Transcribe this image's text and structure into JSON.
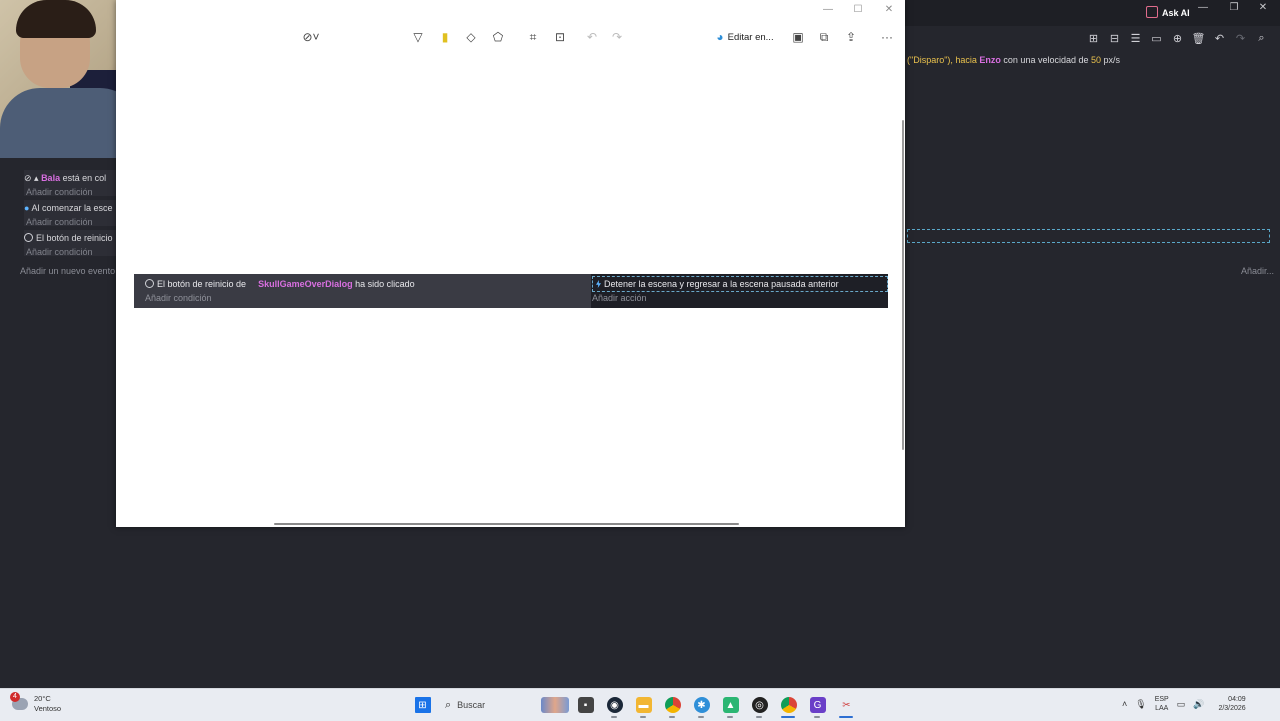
{
  "background_editor": {
    "ask_ai_label": "Ask AI",
    "event_text": {
      "prefix": "(\"Disparo\"), hacia ",
      "object": "Enzo",
      "middle": " con una velocidad de ",
      "speed": "50",
      "unit": " px/s"
    },
    "left_rows": [
      {
        "object": "Bala",
        "text": " está en col"
      },
      {
        "text": "Al comenzar la esce"
      },
      {
        "text": "El botón de reinicio"
      }
    ],
    "add_condition": "Añadir condición",
    "add_event": "Añadir un nuevo evento",
    "add_right": "Añadir..."
  },
  "snip_tool": {
    "edit_in_label": "Editar en...",
    "icons": [
      "timer-icon",
      "pen-icon",
      "highlighter-icon",
      "eraser-icon",
      "shape-icon",
      "crop-icon",
      "text-actions-icon",
      "undo-icon",
      "redo-icon",
      "edit-in-icon",
      "save-icon",
      "copy-icon",
      "share-icon",
      "more-icon"
    ]
  },
  "captured_event": {
    "condition_prefix": "El botón de reinicio de",
    "condition_object": "SkullGameOverDialog",
    "condition_suffix": " ha sido clicado",
    "add_condition": "Añadir condición",
    "action_text": "Detener la escena y regresar a la escena pausada anterior",
    "add_action": "Añadir acción"
  },
  "taskbar": {
    "weather_temp": "20°C",
    "weather_desc": "Ventoso",
    "weather_badge": "4",
    "search_placeholder": "Buscar",
    "lang_top": "ESP",
    "lang_bottom": "LAA",
    "time": "04:09",
    "date": "2/3/2026"
  },
  "colors": {
    "editor_bg": "#25262d",
    "object_name": "#d86fe0",
    "number": "#e9c14d",
    "dashed_selection": "#6aa8c9",
    "taskbar_bg": "#e9ecf2"
  }
}
